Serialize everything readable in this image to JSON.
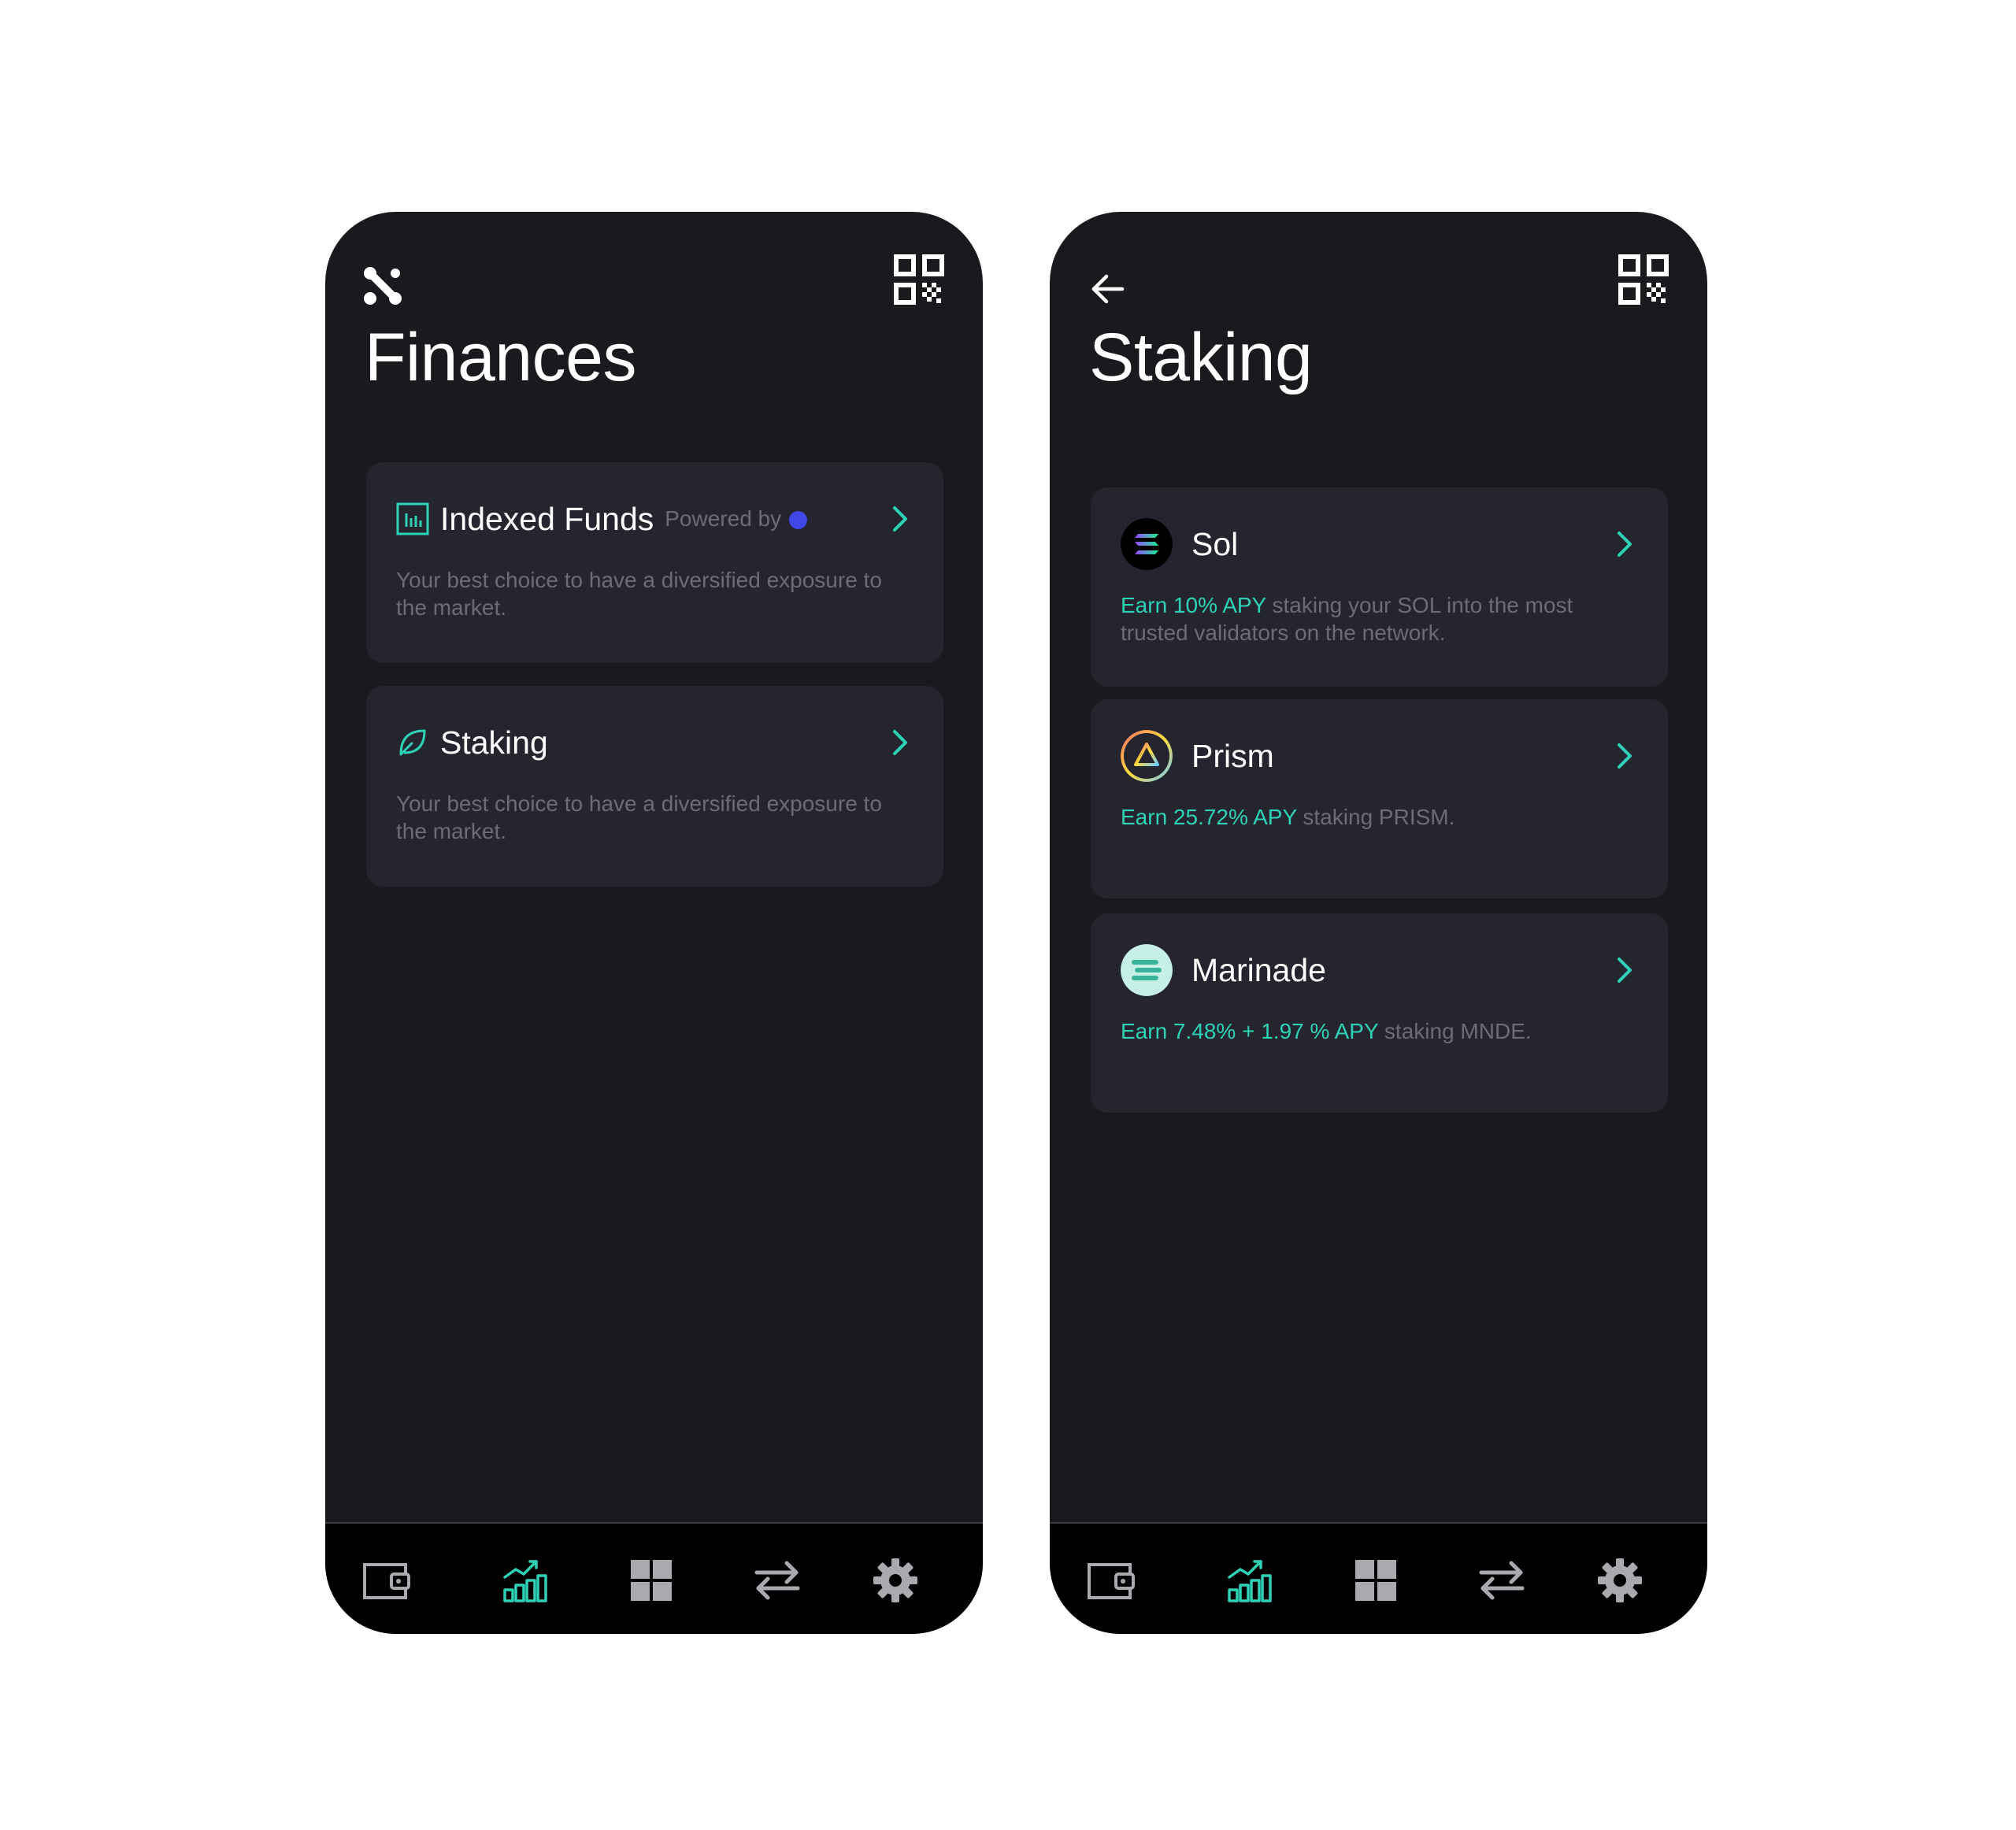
{
  "finances_screen": {
    "title": "Finances",
    "cards": [
      {
        "title": "Indexed Funds",
        "powered_by": "Powered by",
        "description": "Your best choice to have a diversified exposure to the market."
      },
      {
        "title": "Staking",
        "description": "Your best choice to have a diversified exposure to the market."
      }
    ]
  },
  "staking_screen": {
    "title": "Staking",
    "options": [
      {
        "name": "Sol",
        "highlight": "Earn 10% APY",
        "rest": " staking your SOL into the most trusted validators on the network."
      },
      {
        "name": "Prism",
        "highlight": "Earn 25.72% APY",
        "rest": " staking PRISM."
      },
      {
        "name": "Marinade",
        "highlight": "Earn 7.48% + 1.97 % APY",
        "rest": " staking MNDE."
      }
    ]
  },
  "bottom_nav": {
    "items": [
      "wallet-icon",
      "finance-chart-icon",
      "apps-grid-icon",
      "swap-arrows-icon",
      "settings-gear-icon"
    ],
    "active_item": "finance-chart-icon"
  },
  "colors": {
    "accent": "#2ed3b7",
    "background": "#1a1a1e",
    "card": "#25252f",
    "muted_text": "#6c6c77",
    "nav_background": "#000000"
  }
}
